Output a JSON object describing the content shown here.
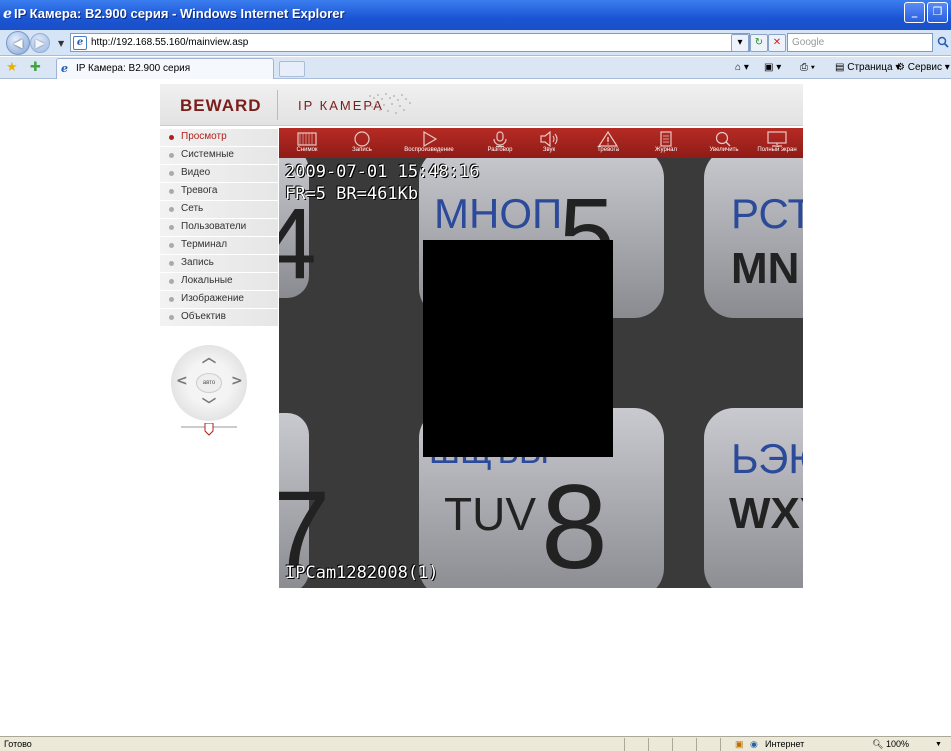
{
  "window": {
    "title": "IP Камера: B2.900 серия - Windows Internet Explorer"
  },
  "address": {
    "url": "http://192.168.55.160/mainview.asp",
    "search_placeholder": "Google"
  },
  "tabs": {
    "active_label": "IP Камера: B2.900 серия"
  },
  "commands": {
    "page": "Страница",
    "service": "Сервис"
  },
  "header": {
    "logo": "BEWARD",
    "product": "IP КАМЕРА"
  },
  "menu": {
    "items": [
      {
        "label": "Просмотр",
        "active": true
      },
      {
        "label": "Системные",
        "active": false
      },
      {
        "label": "Видео",
        "active": false
      },
      {
        "label": "Тревога",
        "active": false
      },
      {
        "label": "Сеть",
        "active": false
      },
      {
        "label": "Пользователи",
        "active": false
      },
      {
        "label": "Терминал",
        "active": false
      },
      {
        "label": "Запись",
        "active": false
      },
      {
        "label": "Локальные",
        "active": false
      },
      {
        "label": "Изображение",
        "active": false
      },
      {
        "label": "Объектив",
        "active": false
      }
    ]
  },
  "ptz": {
    "center_label": "авто"
  },
  "toolbar": {
    "items": [
      {
        "label": "Снимок",
        "icon": "film-icon"
      },
      {
        "label": "Запись",
        "icon": "record-circle-icon"
      },
      {
        "label": "Воспроизведение",
        "icon": "play-icon"
      },
      {
        "label": "Разговор",
        "icon": "microphone-icon"
      },
      {
        "label": "Звук",
        "icon": "speaker-icon"
      },
      {
        "label": "Тревога",
        "icon": "alarm-icon"
      },
      {
        "label": "Журнал",
        "icon": "log-icon"
      },
      {
        "label": "Увеличить",
        "icon": "magnifier-icon"
      },
      {
        "label": "Полный экран",
        "icon": "fullscreen-monitor-icon"
      }
    ]
  },
  "video": {
    "osd_datetime": "2009-07-01 15:48:16",
    "osd_stats": "FR=5 BR=461Kb",
    "osd_camera": "IPCam1282008(1)",
    "keypad_text": [
      "МНОП",
      "5",
      "РСТ",
      "MN",
      "4",
      "7",
      "ШЩЪЫ",
      "TUV",
      "8",
      "ЬЭЮ",
      "WXY"
    ]
  },
  "status": {
    "left": "Готово",
    "zone": "Интернет",
    "zoom": "100%"
  },
  "colors": {
    "brand": "#7a1e1c",
    "toolbar": "#a5241f",
    "xp_title": "#1f5ad6"
  }
}
